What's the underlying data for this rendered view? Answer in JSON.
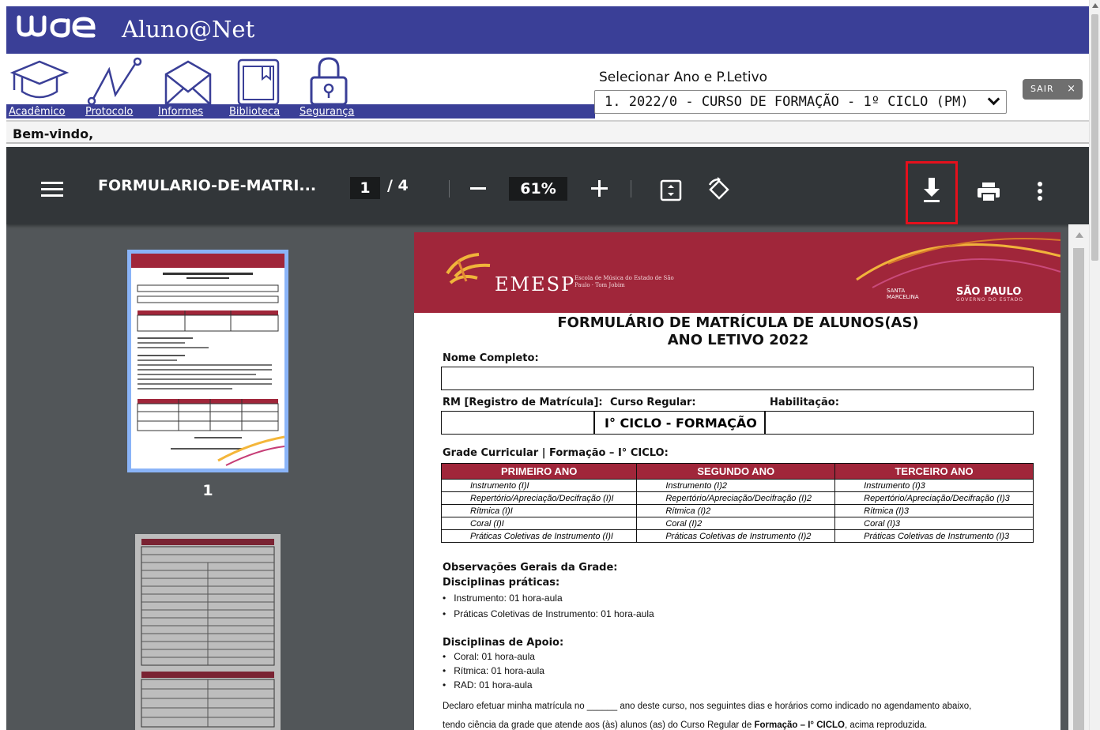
{
  "app": {
    "title": "Aluno@Net"
  },
  "nav": {
    "items": [
      {
        "label": "Acadêmico",
        "icon": "graduation-cap-icon"
      },
      {
        "label": "Protocolo",
        "icon": "line-chart-icon"
      },
      {
        "label": "Informes",
        "icon": "envelope-icon"
      },
      {
        "label": "Biblioteca",
        "icon": "book-icon"
      },
      {
        "label": "Segurança",
        "icon": "padlock-icon"
      }
    ]
  },
  "period": {
    "label": "Selecionar Ano e P.Letivo",
    "selected": "1. 2022/0 - CURSO DE FORMAÇÃO - 1º CICLO (PM)"
  },
  "logout": {
    "label": "SAIR",
    "close": "×"
  },
  "welcome": {
    "text": "Bem-vindo,"
  },
  "pdf_toolbar": {
    "doc_name": "FORMULARIO-DE-MATRI...",
    "current_page": "1",
    "page_total": "/  4",
    "zoom": "61%"
  },
  "thumbnails": {
    "first_label": "1"
  },
  "document": {
    "brand": "EMESP",
    "brand_sub": "Escola de Música do Estado de São Paulo · Tom Jobim",
    "partner": "SANTA MARCELINA",
    "gov": "SÃO PAULO",
    "gov_sub": "GOVERNO DO ESTADO",
    "title_line1": "FORMULÁRIO DE MATRÍCULA DE ALUNOS(AS)",
    "title_line2": "ANO LETIVO 2022",
    "name_label": "Nome Completo:",
    "rm_label": "RM [Registro de Matrícula]:",
    "course_label": "Curso Regular:",
    "habilitation_label": "Habilitação:",
    "course_value": "I° CICLO - FORMAÇÃO",
    "grade_title": "Grade Curricular | Formação – I° CICLO:",
    "grade_headers": [
      "PRIMEIRO ANO",
      "SEGUNDO ANO",
      "TERCEIRO ANO"
    ],
    "grade_rows": [
      [
        "Instrumento (I)I",
        "Instrumento (I)2",
        "Instrumento (I)3"
      ],
      [
        "Repertório/Apreciação/Decifração (I)I",
        "Repertório/Apreciação/Decifração (I)2",
        "Repertório/Apreciação/Decifração (I)3"
      ],
      [
        "Rítmica (I)I",
        "Rítmica (I)2",
        "Rítmica (I)3"
      ],
      [
        "Coral (I)I",
        "Coral (I)2",
        "Coral (I)3"
      ],
      [
        "Práticas Coletivas de Instrumento (I)I",
        "Práticas Coletivas de Instrumento (I)2",
        "Práticas Coletivas de Instrumento (I)3"
      ]
    ],
    "obs_title": "Observações Gerais da Grade:",
    "practical_title": "Disciplinas práticas:",
    "practical_items": [
      "Instrumento: 01 hora-aula",
      "Práticas Coletivas de Instrumento: 01 hora-aula"
    ],
    "support_title": "Disciplinas de Apoio:",
    "support_items": [
      "Coral: 01 hora-aula",
      "Rítmica: 01 hora-aula",
      "RAD: 01 hora-aula"
    ],
    "declare_line1": "Declaro efetuar minha matrícula no ______ ano deste curso, nos seguintes dias e horários como indicado no agendamento abaixo,",
    "declare_line2_pre": "tendo ciência da grade que atende aos (às) alunos (as) do Curso Regular de ",
    "declare_line2_bold": "Formação – I° CICLO",
    "declare_line2_post": ", acima reproduzida."
  }
}
